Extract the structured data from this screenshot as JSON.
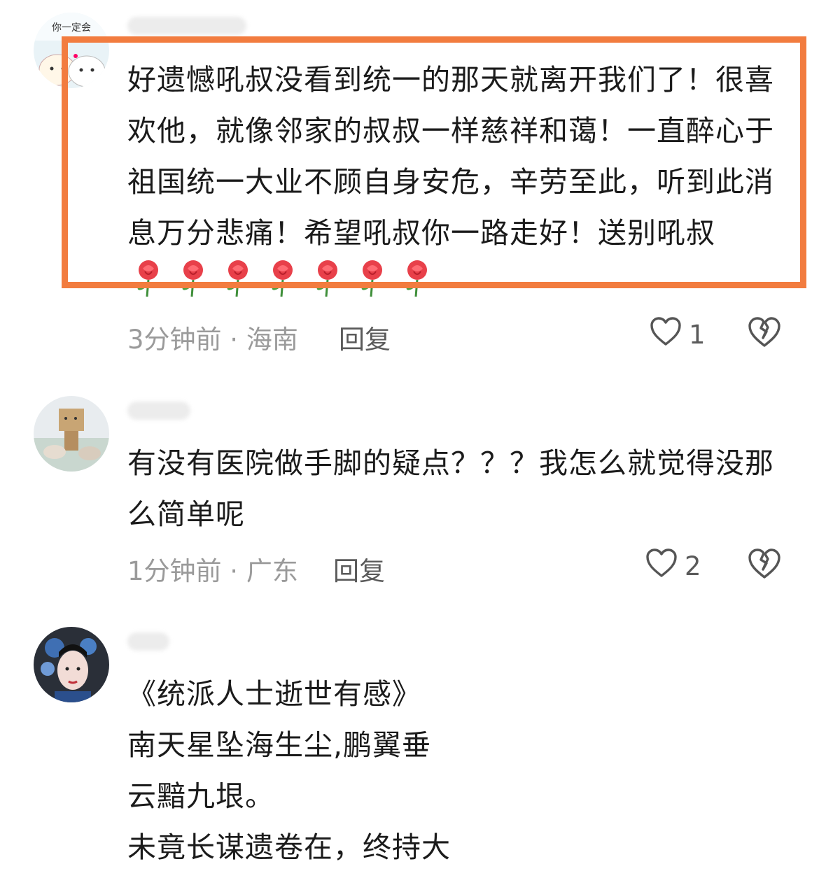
{
  "comments": [
    {
      "text": "好遗憾吼叔没看到统一的那天就离开我们了！很喜欢他，就像邻家的叔叔一样慈祥和蔼！一直醉心于祖国统一大业不顾自身安危，辛劳至此，听到此消息万分悲痛！希望吼叔你一路走好！送别吼叔",
      "emoji": "rose-emoji",
      "emoji_count": 7,
      "time_location": "3分钟前 · 海南",
      "reply_label": "回复",
      "likes": "1",
      "avatar_text": "你一定会"
    },
    {
      "text": "有没有医院做手脚的疑点？？？我怎么就觉得没那么简单呢",
      "time_location": "1分钟前 · 广东",
      "reply_label": "回复",
      "likes": "2"
    },
    {
      "poem": {
        "title": "《统派人士逝世有感》",
        "line_1": "南天星坠海生尘,鹏翼垂",
        "line_2": "云黯九垠。",
        "line_3": "未竟长谋遗卷在，终持大"
      }
    }
  ],
  "colors": {
    "highlight_border": "#f27c3f",
    "meta_gray": "#9a9a9a",
    "text": "#1b1b1b"
  },
  "icons": {
    "like": "heart-outline-icon",
    "dislike": "broken-heart-icon"
  }
}
